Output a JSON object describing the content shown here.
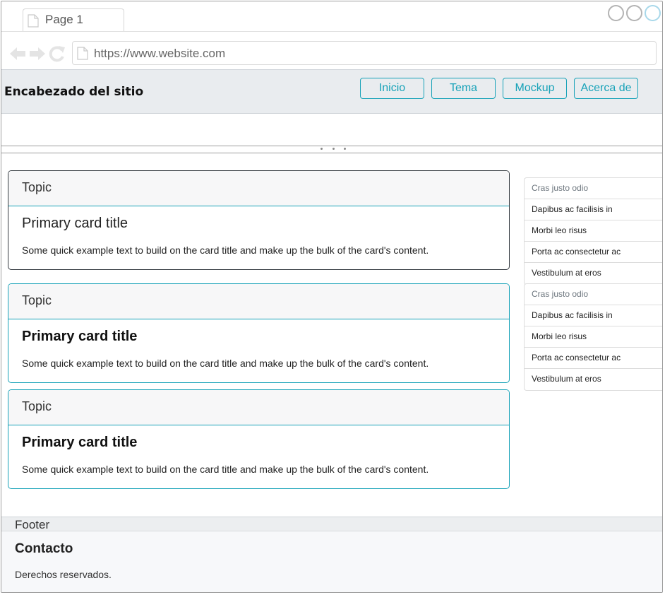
{
  "browser": {
    "tab_title": "Page 1",
    "url": "https://www.website.com"
  },
  "header": {
    "site_title": "Encabezado del sitio",
    "nav": [
      "Inicio",
      "Tema",
      "Mockup",
      "Acerca de"
    ]
  },
  "cards": [
    {
      "header": "Topic",
      "title": "Primary card title",
      "text": "Some quick example text to build on the card title and make up the bulk of the card's content."
    },
    {
      "header": "Topic",
      "title": "Primary card title",
      "text": "Some quick example text to build on the card title and make up the bulk of the card's content."
    },
    {
      "header": "Topic",
      "title": "Primary card title",
      "text": "Some quick example text to build on the card title and make up the bulk of the card's content."
    }
  ],
  "lists": [
    {
      "items": [
        "Cras justo odio",
        "Dapibus ac facilisis in",
        "Morbi leo risus",
        "Porta ac consectetur ac",
        "Vestibulum at eros"
      ]
    },
    {
      "items": [
        "Cras justo odio",
        "Dapibus ac facilisis in",
        "Morbi leo risus",
        "Porta ac consectetur ac",
        "Vestibulum at eros"
      ]
    }
  ],
  "footer": {
    "label": "Footer",
    "heading": "Contacto",
    "text": "Derechos reservados."
  },
  "colors": {
    "accent": "#17a2b8",
    "header_bg": "#e9ecef",
    "card_header_bg": "#f7f7f8",
    "dark_border": "#343a40"
  },
  "icons": [
    "document-icon",
    "back-arrow-icon",
    "forward-arrow-icon",
    "reload-icon",
    "window-control-icon"
  ]
}
